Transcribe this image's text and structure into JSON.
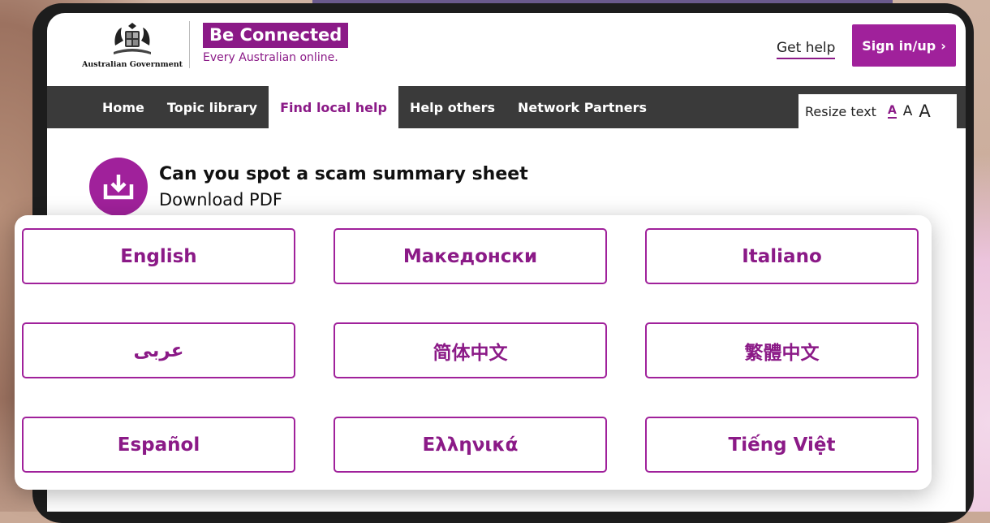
{
  "header": {
    "government": "Australian Government",
    "brand_name": "Be Connected",
    "brand_tagline": "Every Australian online.",
    "get_help": "Get help",
    "sign_in": "Sign in/up",
    "sign_in_chevron": "›"
  },
  "nav": {
    "items": [
      "Home",
      "Topic library",
      "Find local help",
      "Help others",
      "Network Partners"
    ],
    "active_index": 2
  },
  "resize": {
    "label": "Resize text",
    "small": "A",
    "medium": "A",
    "large": "A"
  },
  "download": {
    "title": "Can you spot a scam summary sheet",
    "link": "Download PDF"
  },
  "languages": [
    "English",
    "Македонски",
    "Italiano",
    "عربى",
    "简体中文",
    "繁體中文",
    "Español",
    "Ελληνικά",
    "Tiếng Việt"
  ],
  "colors": {
    "brand": "#8b1a87",
    "button": "#a0219b",
    "nav_bg": "#3a3a3a"
  }
}
